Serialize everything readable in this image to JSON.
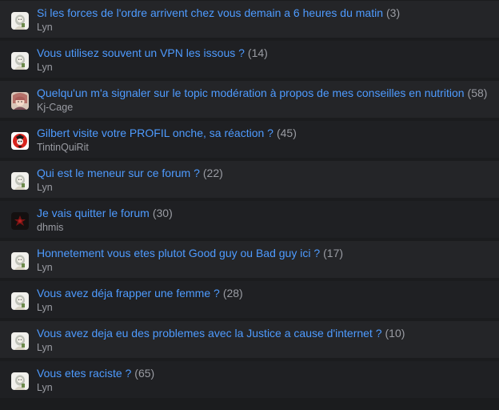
{
  "topics": [
    {
      "title": "Si les forces de l'ordre arrivent chez vous demain a 6 heures du matin",
      "count": "(3)",
      "author": "Lyn",
      "avatar": "default-avatar-icon"
    },
    {
      "title": "Vous utilisez souvent un VPN les issous ?",
      "count": "(14)",
      "author": "Lyn",
      "avatar": "default-avatar-icon"
    },
    {
      "title": "Quelqu'un m'a signaler sur le topic modération à propos de mes conseilles en nutrition",
      "count": "(58)",
      "author": "Kj-Cage",
      "avatar": "anime-avatar-icon"
    },
    {
      "title": "Gilbert visite votre PROFIL onche, sa réaction ?",
      "count": "(45)",
      "author": "TintinQuiRit",
      "avatar": "red-avatar-icon"
    },
    {
      "title": "Qui est le meneur sur ce forum ?",
      "count": "(22)",
      "author": "Lyn",
      "avatar": "default-avatar-icon"
    },
    {
      "title": "Je vais quitter le forum",
      "count": "(30)",
      "author": "dhmis",
      "avatar": "dark-avatar-icon"
    },
    {
      "title": "Honnetement vous etes plutot Good guy ou Bad guy ici ?",
      "count": "(17)",
      "author": "Lyn",
      "avatar": "default-avatar-icon"
    },
    {
      "title": "Vous avez déja frapper une femme ?",
      "count": "(28)",
      "author": "Lyn",
      "avatar": "default-avatar-icon"
    },
    {
      "title": "Vous avez deja eu des problemes avec la Justice a cause d'internet ?",
      "count": "(10)",
      "author": "Lyn",
      "avatar": "default-avatar-icon"
    },
    {
      "title": "Vous etes raciste ?",
      "count": "(65)",
      "author": "Lyn",
      "avatar": "default-avatar-icon"
    }
  ],
  "colors": {
    "link": "#4e9bff",
    "muted": "#9a9ca3",
    "row": "#242528",
    "background": "#1b1c1e"
  }
}
